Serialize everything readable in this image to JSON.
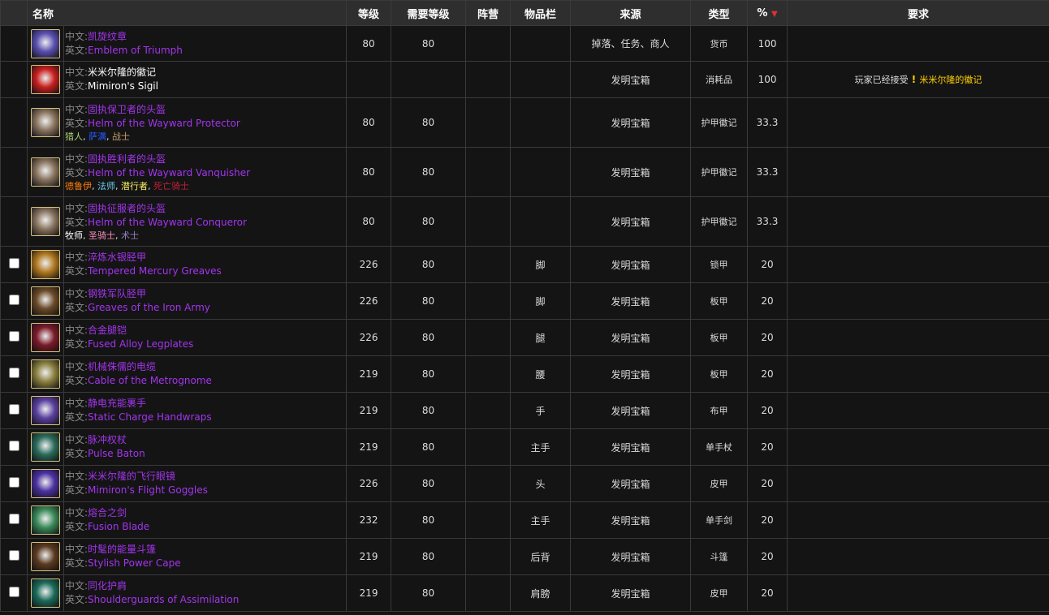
{
  "headers": {
    "name": "名称",
    "level": "等级",
    "req_level": "需要等级",
    "faction": "阵营",
    "slot": "物品栏",
    "source": "来源",
    "type": "类型",
    "pct": "%",
    "requirement": "要求"
  },
  "labels": {
    "cn": "中文:",
    "en": "英文:"
  },
  "rows": [
    {
      "checkbox": false,
      "icon": "emblem-icon",
      "icon_color": "#5a4fb0",
      "cn": "凯旋纹章",
      "en": "Emblem of Triumph",
      "color": "purple",
      "level": "80",
      "req": "80",
      "slot": "",
      "source": "掉落、任务、商人",
      "type": "货币",
      "pct": "100",
      "requirement": "",
      "classes": [],
      "h": 44
    },
    {
      "checkbox": false,
      "icon": "sigil-icon",
      "icon_color": "#c81f1f",
      "cn": "米米尔隆的徽记",
      "en": "Mimiron's Sigil",
      "color": "white",
      "level": "",
      "req": "",
      "slot": "",
      "source": "发明宝箱",
      "type": "消耗品",
      "pct": "100",
      "requirement": "玩家已经接受",
      "requirement_link": "米米尔隆的徽记",
      "classes": [],
      "h": 45
    },
    {
      "checkbox": false,
      "icon": "helm-icon",
      "icon_color": "#8a7560",
      "cn": "固执保卫者的头盔",
      "en": "Helm of the Wayward Protector",
      "color": "purple",
      "level": "80",
      "req": "80",
      "slot": "",
      "source": "发明宝箱",
      "type": "护甲徽记",
      "pct": "33.3",
      "requirement": "",
      "classes": [
        {
          "n": "猎人",
          "c": "#abd473"
        },
        {
          "n": "萨满",
          "c": "#2459ff"
        },
        {
          "n": "战士",
          "c": "#c79c6e"
        }
      ],
      "h": 61
    },
    {
      "checkbox": false,
      "icon": "helm-icon",
      "icon_color": "#8a7560",
      "cn": "固执胜利者的头盔",
      "en": "Helm of the Wayward Vanquisher",
      "color": "purple",
      "level": "80",
      "req": "80",
      "slot": "",
      "source": "发明宝箱",
      "type": "护甲徽记",
      "pct": "33.3",
      "requirement": "",
      "classes": [
        {
          "n": "德鲁伊",
          "c": "#ff7d0a"
        },
        {
          "n": "法师",
          "c": "#69ccf0"
        },
        {
          "n": "潜行者",
          "c": "#fff569"
        },
        {
          "n": "死亡骑士",
          "c": "#c41f3b"
        }
      ],
      "h": 61
    },
    {
      "checkbox": false,
      "icon": "helm-icon",
      "icon_color": "#8a7560",
      "cn": "固执征服者的头盔",
      "en": "Helm of the Wayward Conqueror",
      "color": "purple",
      "level": "80",
      "req": "80",
      "slot": "",
      "source": "发明宝箱",
      "type": "护甲徽记",
      "pct": "33.3",
      "requirement": "",
      "classes": [
        {
          "n": "牧师",
          "c": "#ffffff"
        },
        {
          "n": "圣骑士",
          "c": "#f58cba"
        },
        {
          "n": "术士",
          "c": "#9482c9"
        }
      ],
      "h": 61
    },
    {
      "checkbox": true,
      "icon": "greaves-icon",
      "icon_color": "#b07820",
      "cn": "淬炼水银胫甲",
      "en": "Tempered Mercury Greaves",
      "color": "purple",
      "level": "226",
      "req": "80",
      "slot": "脚",
      "source": "发明宝箱",
      "type": "锁甲",
      "pct": "20",
      "requirement": "",
      "classes": [],
      "h": 45
    },
    {
      "checkbox": true,
      "icon": "boots-icon",
      "icon_color": "#6b4a28",
      "cn": "钢铁军队胫甲",
      "en": "Greaves of the Iron Army",
      "color": "purple",
      "level": "226",
      "req": "80",
      "slot": "脚",
      "source": "发明宝箱",
      "type": "板甲",
      "pct": "20",
      "requirement": "",
      "classes": [],
      "h": 45
    },
    {
      "checkbox": true,
      "icon": "legplates-icon",
      "icon_color": "#7a1a2a",
      "cn": "合金腿铠",
      "en": "Fused Alloy Legplates",
      "color": "purple",
      "level": "226",
      "req": "80",
      "slot": "腿",
      "source": "发明宝箱",
      "type": "板甲",
      "pct": "20",
      "requirement": "",
      "classes": [],
      "h": 45
    },
    {
      "checkbox": true,
      "icon": "belt-icon",
      "icon_color": "#8a8040",
      "cn": "机械侏儒的电缆",
      "en": "Cable of the Metrognome",
      "color": "purple",
      "level": "219",
      "req": "80",
      "slot": "腰",
      "source": "发明宝箱",
      "type": "板甲",
      "pct": "20",
      "requirement": "",
      "classes": [],
      "h": 45
    },
    {
      "checkbox": true,
      "icon": "handwraps-icon",
      "icon_color": "#5a40a0",
      "cn": "静电充能裹手",
      "en": "Static Charge Handwraps",
      "color": "purple",
      "level": "219",
      "req": "80",
      "slot": "手",
      "source": "发明宝箱",
      "type": "布甲",
      "pct": "20",
      "requirement": "",
      "classes": [],
      "h": 45
    },
    {
      "checkbox": true,
      "icon": "baton-icon",
      "icon_color": "#2a6a5a",
      "cn": "脉冲权杖",
      "en": "Pulse Baton",
      "color": "purple",
      "level": "219",
      "req": "80",
      "slot": "主手",
      "source": "发明宝箱",
      "type": "单手杖",
      "pct": "20",
      "requirement": "",
      "classes": [],
      "h": 45
    },
    {
      "checkbox": true,
      "icon": "goggles-icon",
      "icon_color": "#4a30a0",
      "cn": "米米尔隆的飞行眼镜",
      "en": "Mimiron's Flight Goggles",
      "color": "purple",
      "level": "226",
      "req": "80",
      "slot": "头",
      "source": "发明宝箱",
      "type": "皮甲",
      "pct": "20",
      "requirement": "",
      "classes": [],
      "h": 45
    },
    {
      "checkbox": true,
      "icon": "blade-icon",
      "icon_color": "#3a8a5a",
      "cn": "熔合之剑",
      "en": "Fusion Blade",
      "color": "purple",
      "level": "232",
      "req": "80",
      "slot": "主手",
      "source": "发明宝箱",
      "type": "单手剑",
      "pct": "20",
      "requirement": "",
      "classes": [],
      "h": 45
    },
    {
      "checkbox": true,
      "icon": "cape-icon",
      "icon_color": "#5a3a20",
      "cn": "时髦的能量斗篷",
      "en": "Stylish Power Cape",
      "color": "purple",
      "level": "219",
      "req": "80",
      "slot": "后背",
      "source": "发明宝箱",
      "type": "斗篷",
      "pct": "20",
      "requirement": "",
      "classes": [],
      "h": 45
    },
    {
      "checkbox": true,
      "icon": "shoulders-icon",
      "icon_color": "#1a6a5a",
      "cn": "同化护肩",
      "en": "Shoulderguards of Assimilation",
      "color": "purple",
      "level": "219",
      "req": "80",
      "slot": "肩膀",
      "source": "发明宝箱",
      "type": "皮甲",
      "pct": "20",
      "requirement": "",
      "classes": [],
      "h": 45
    }
  ]
}
